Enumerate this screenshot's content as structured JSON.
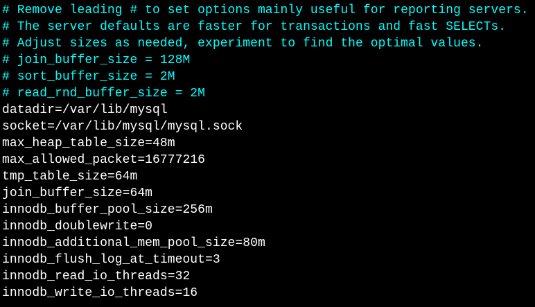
{
  "colors": {
    "background": "#000000",
    "comment": "#00ffff",
    "text": "#ffffff"
  },
  "lines": [
    {
      "kind": "comment",
      "text": "# Remove leading # to set options mainly useful for reporting servers."
    },
    {
      "kind": "comment",
      "text": "# The server defaults are faster for transactions and fast SELECTs."
    },
    {
      "kind": "comment",
      "text": "# Adjust sizes as needed, experiment to find the optimal values."
    },
    {
      "kind": "comment",
      "text": "# join_buffer_size = 128M"
    },
    {
      "kind": "comment",
      "text": "# sort_buffer_size = 2M"
    },
    {
      "kind": "comment",
      "text": "# read_rnd_buffer_size = 2M"
    },
    {
      "kind": "setting",
      "text": "datadir=/var/lib/mysql"
    },
    {
      "kind": "setting",
      "text": "socket=/var/lib/mysql/mysql.sock"
    },
    {
      "kind": "setting",
      "text": "max_heap_table_size=48m"
    },
    {
      "kind": "setting",
      "text": "max_allowed_packet=16777216"
    },
    {
      "kind": "setting",
      "text": "tmp_table_size=64m"
    },
    {
      "kind": "setting",
      "text": "join_buffer_size=64m"
    },
    {
      "kind": "setting",
      "text": "innodb_buffer_pool_size=256m"
    },
    {
      "kind": "setting",
      "text": "innodb_doublewrite=0"
    },
    {
      "kind": "setting",
      "text": "innodb_additional_mem_pool_size=80m"
    },
    {
      "kind": "setting",
      "text": "innodb_flush_log_at_timeout=3"
    },
    {
      "kind": "setting",
      "text": "innodb_read_io_threads=32"
    },
    {
      "kind": "setting",
      "text": "innodb_write_io_threads=16"
    }
  ]
}
